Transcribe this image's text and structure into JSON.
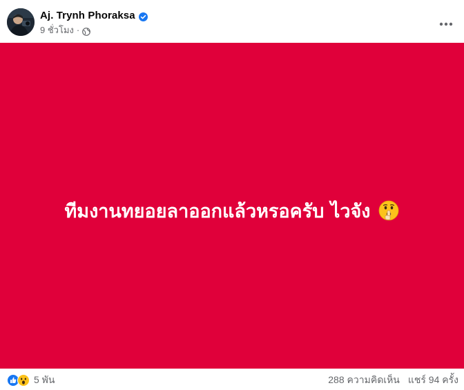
{
  "post": {
    "author": "Aj. Trynh Phoraksa",
    "verified": true,
    "time": "9 ชั่วโมง",
    "privacy_icon": "globe-icon",
    "more_icon": "more-horizontal-icon",
    "background_color": "#e0003a",
    "text": "ทีมงานทยอยลาออกแล้วหรอครับ ไวจัง",
    "emoji": "shushing-face-emoji"
  },
  "reactions": {
    "icons": [
      "like-reaction-icon",
      "wow-reaction-icon"
    ],
    "count": "5 พัน"
  },
  "stats": {
    "comments": "288 ความคิดเห็น",
    "shares": "แชร์ 94 ครั้ง"
  }
}
